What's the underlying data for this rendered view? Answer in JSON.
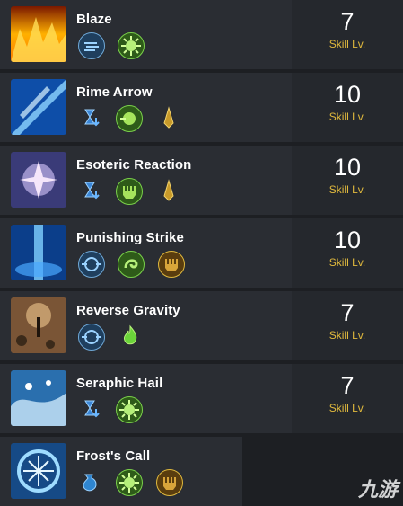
{
  "skills": [
    {
      "name": "Blaze",
      "level": "7",
      "level_label": "Skill Lv.",
      "thumb": "fire-thumb",
      "icons": [
        "wind-icon",
        "gear-burst-icon"
      ]
    },
    {
      "name": "Rime Arrow",
      "level": "10",
      "level_label": "Skill Lv.",
      "thumb": "ice-arrow-thumb",
      "icons": [
        "hourglass-icon",
        "green-orb-icon",
        "golden-spike-icon"
      ]
    },
    {
      "name": "Esoteric Reaction",
      "level": "10",
      "level_label": "Skill Lv.",
      "thumb": "crystal-flower-thumb",
      "icons": [
        "hourglass-icon",
        "green-tooth-icon",
        "golden-spike-icon"
      ]
    },
    {
      "name": "Punishing Strike",
      "level": "10",
      "level_label": "Skill Lv.",
      "thumb": "blue-pillar-thumb",
      "icons": [
        "target-icon",
        "green-swirl-icon",
        "golden-tooth-icon"
      ]
    },
    {
      "name": "Reverse Gravity",
      "level": "7",
      "level_label": "Skill Lv.",
      "thumb": "rock-levitate-thumb",
      "icons": [
        "target-icon",
        "green-flame-icon"
      ]
    },
    {
      "name": "Seraphic Hail",
      "level": "7",
      "level_label": "Skill Lv.",
      "thumb": "hail-thumb",
      "icons": [
        "hourglass-icon",
        "gear-burst-icon"
      ]
    },
    {
      "name": "Frost's Call",
      "level": "",
      "level_label": "",
      "thumb": "frost-rune-thumb",
      "icons": [
        "potion-icon",
        "gear-burst-icon",
        "golden-tooth-icon"
      ]
    }
  ],
  "watermark": "九游",
  "colors": {
    "accent": "#e0b93d",
    "row_bg": "#2a2d33",
    "page_bg": "#1d1f23"
  }
}
